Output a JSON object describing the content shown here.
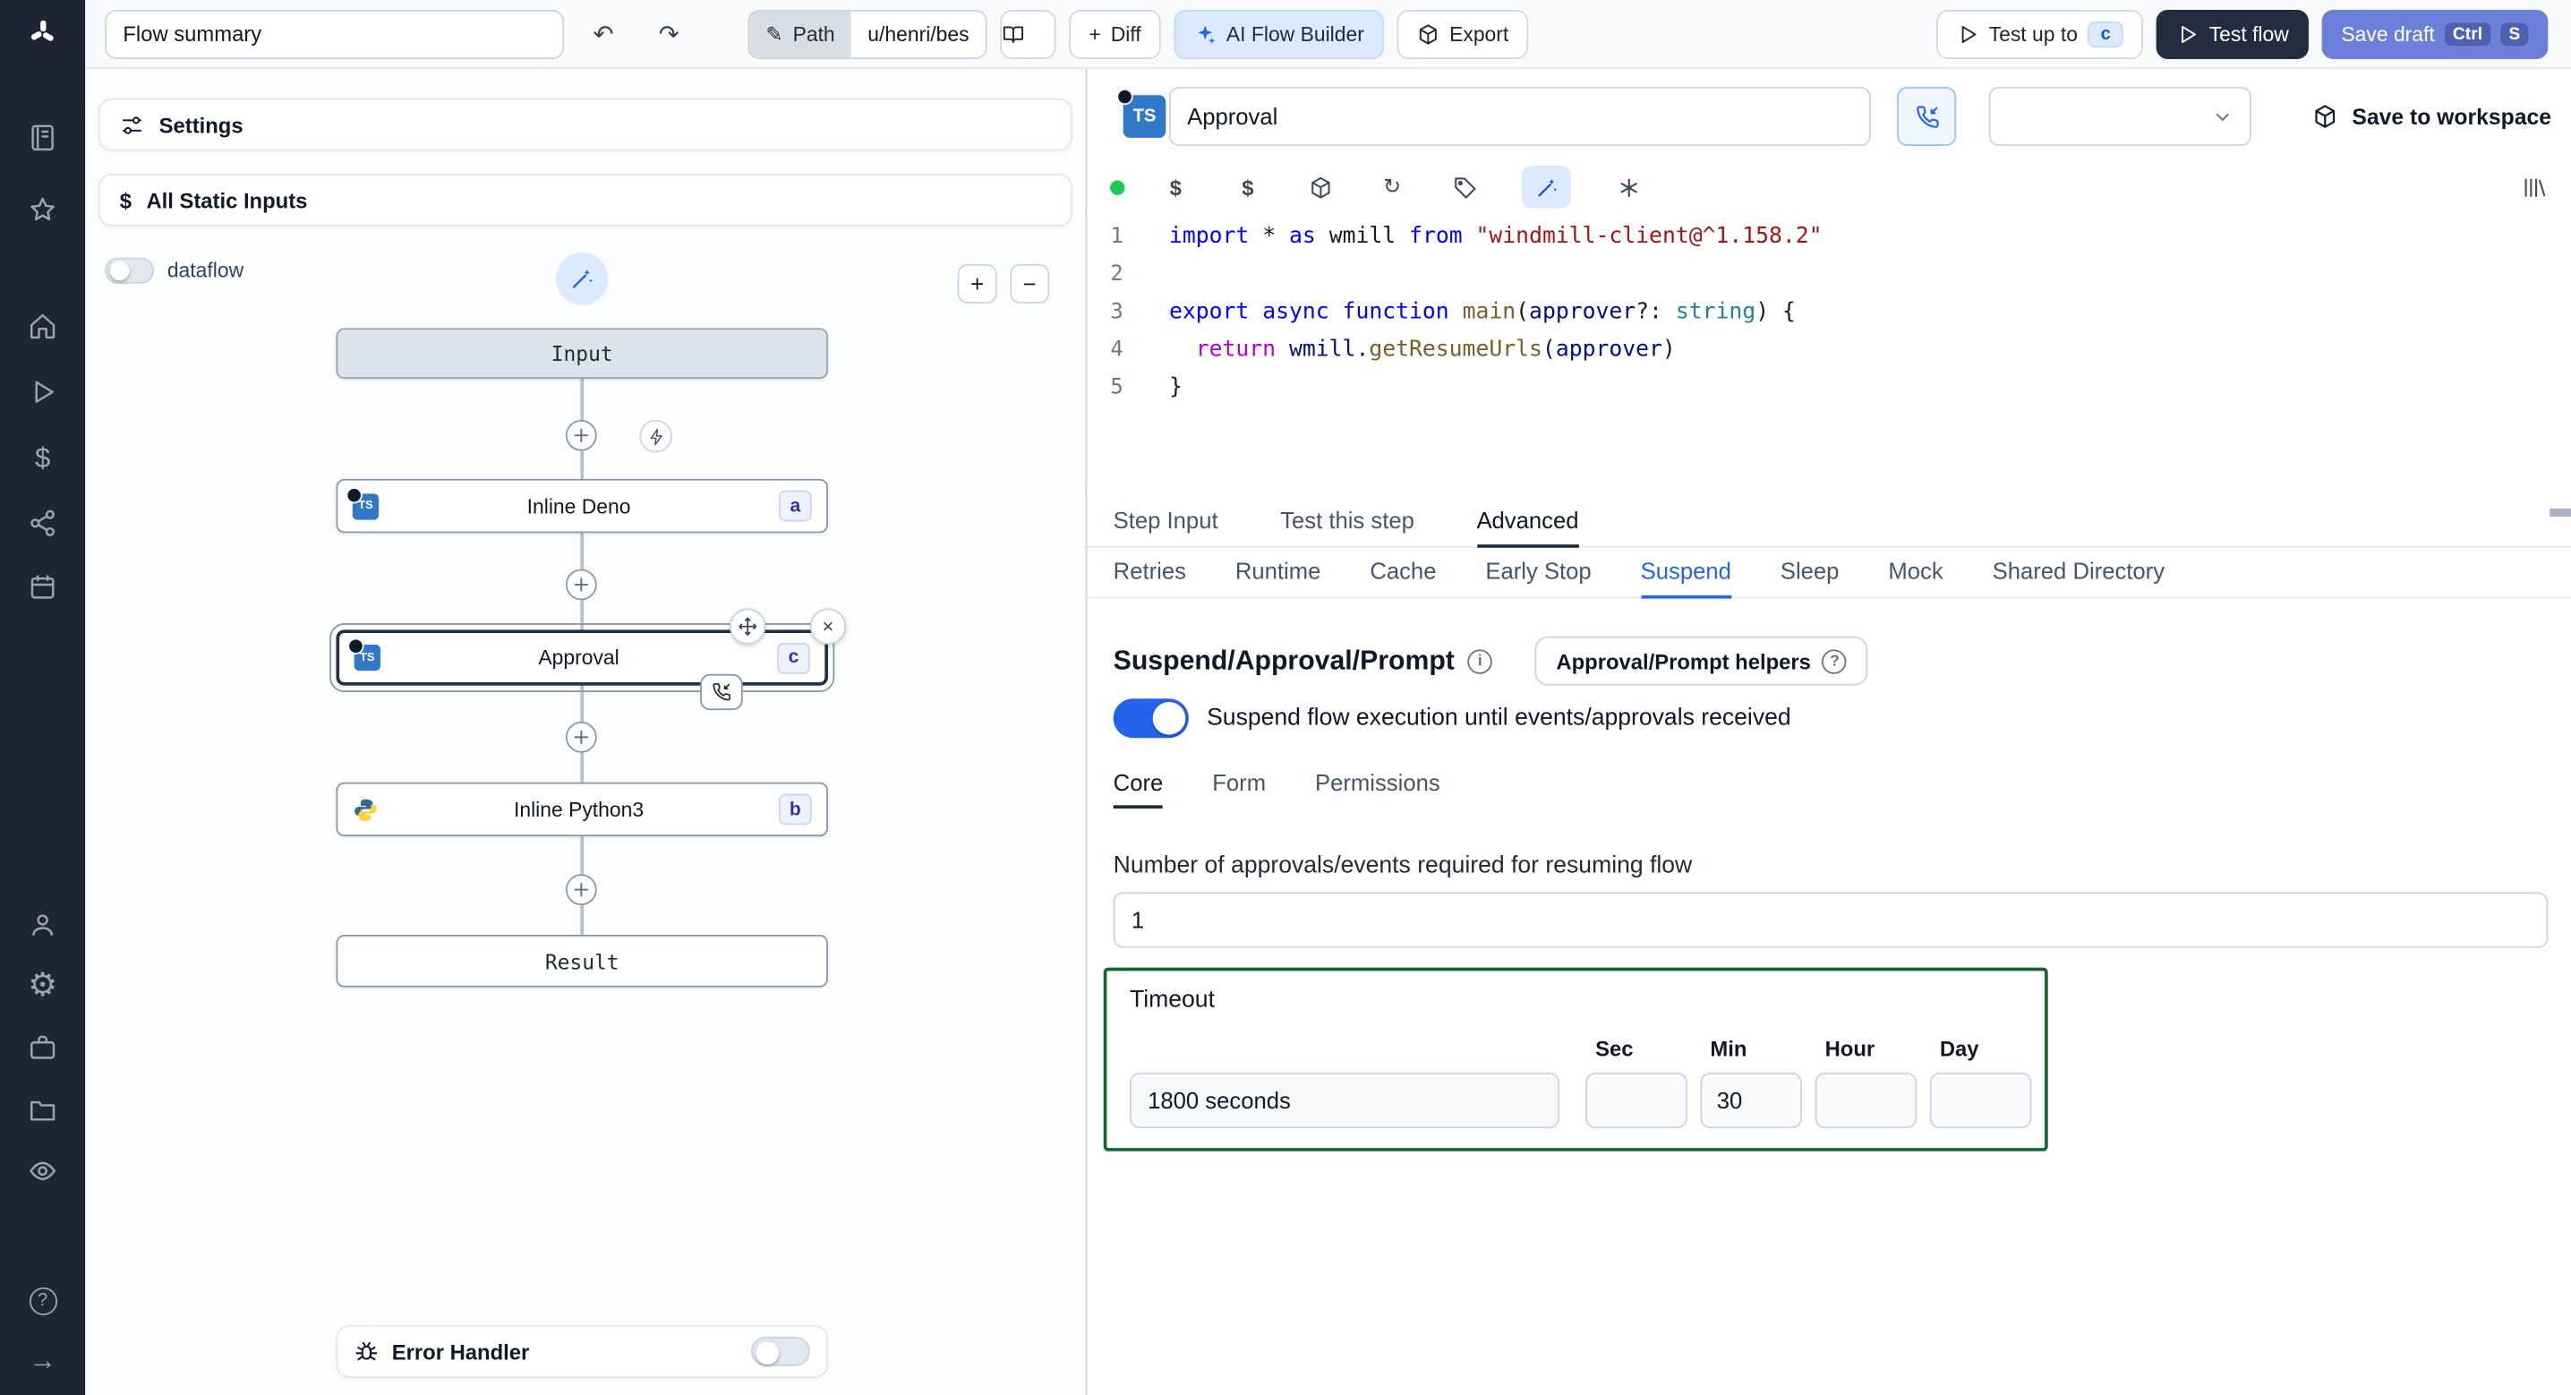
{
  "colors": {
    "accent": "#2563eb",
    "timeout_border": "#166534",
    "save_draft_bg": "#6c7fd8",
    "test_flow_bg": "#232d40",
    "sidebar_bg": "#1e2633",
    "ai_button_bg": "#dbeafe",
    "toggle_on": "#2563eb",
    "status_dot": "#22c55e",
    "ts_icon": "#3178c6"
  },
  "icons": {
    "undo": "↶",
    "redo": "↷",
    "refresh": "↻",
    "gear": "⚙",
    "arrow_right": "→",
    "pen": "✎",
    "close": "×",
    "plus": "+",
    "info": "i",
    "help": "?"
  },
  "topbar": {
    "flow_summary_value": "Flow summary",
    "path_label": "Path",
    "path_value": "u/henri/bes",
    "diff_label": "Diff",
    "ai_builder_label": "AI Flow Builder",
    "export_label": "Export",
    "test_up_to_label": "Test up to",
    "test_up_to_badge": "c",
    "test_flow_label": "Test flow",
    "save_draft_label": "Save draft",
    "save_draft_key_1": "Ctrl",
    "save_draft_key_2": "S"
  },
  "left_panel": {
    "settings_label": "Settings",
    "static_inputs_label": "All Static Inputs",
    "dataflow_label": "dataflow",
    "zoom_in": "+",
    "zoom_out": "−",
    "error_handler_label": "Error Handler",
    "nodes": {
      "input_label": "Input",
      "deno_label": "Inline Deno",
      "deno_badge": "a",
      "approval_label": "Approval",
      "approval_badge": "c",
      "python_label": "Inline Python3",
      "python_badge": "b",
      "result_label": "Result"
    }
  },
  "step_header": {
    "language": "TS",
    "name_value": "Approval",
    "save_to_workspace_label": "Save to workspace"
  },
  "editor": {
    "line_numbers": [
      "1",
      "2",
      "3",
      "4",
      "5"
    ],
    "lines": [
      [
        {
          "t": "import",
          "c": "kw"
        },
        {
          "t": " ",
          "c": "pl"
        },
        {
          "t": "*",
          "c": "pl"
        },
        {
          "t": " ",
          "c": "pl"
        },
        {
          "t": "as",
          "c": "kw"
        },
        {
          "t": " wmill ",
          "c": "pl"
        },
        {
          "t": "from",
          "c": "kw"
        },
        {
          "t": " ",
          "c": "pl"
        },
        {
          "t": "\"windmill-client@^1.158.2\"",
          "c": "str"
        }
      ],
      [],
      [
        {
          "t": "export",
          "c": "kw"
        },
        {
          "t": " ",
          "c": "pl"
        },
        {
          "t": "async",
          "c": "kw"
        },
        {
          "t": " ",
          "c": "pl"
        },
        {
          "t": "function",
          "c": "kw"
        },
        {
          "t": " ",
          "c": "pl"
        },
        {
          "t": "main",
          "c": "fn"
        },
        {
          "t": "(",
          "c": "pl"
        },
        {
          "t": "approver",
          "c": "var"
        },
        {
          "t": "?: ",
          "c": "pl"
        },
        {
          "t": "string",
          "c": "type"
        },
        {
          "t": ") {",
          "c": "pl"
        }
      ],
      [
        {
          "t": "  ",
          "c": "pl"
        },
        {
          "t": "return",
          "c": "ctrl"
        },
        {
          "t": " ",
          "c": "pl"
        },
        {
          "t": "wmill",
          "c": "var"
        },
        {
          "t": ".",
          "c": "pl"
        },
        {
          "t": "getResumeUrls",
          "c": "fn"
        },
        {
          "t": "(",
          "c": "pl"
        },
        {
          "t": "approver",
          "c": "var"
        },
        {
          "t": ")",
          "c": "pl"
        }
      ],
      [
        {
          "t": "}",
          "c": "pl"
        }
      ]
    ]
  },
  "tabs": {
    "main": [
      "Step Input",
      "Test this step",
      "Advanced"
    ],
    "main_selected": "Advanced",
    "advanced": [
      "Retries",
      "Runtime",
      "Cache",
      "Early Stop",
      "Suspend",
      "Sleep",
      "Mock",
      "Shared Directory"
    ],
    "advanced_selected": "Suspend"
  },
  "suspend": {
    "title": "Suspend/Approval/Prompt",
    "helpers_label": "Approval/Prompt helpers",
    "toggle_label": "Suspend flow execution until events/approvals received",
    "sub_tabs": [
      "Core",
      "Form",
      "Permissions"
    ],
    "sub_selected": "Core",
    "approvals_label": "Number of approvals/events required for resuming flow",
    "approvals_value": "1",
    "timeout_label": "Timeout",
    "timeout_value": "1800 seconds",
    "units": [
      {
        "label": "Sec",
        "value": ""
      },
      {
        "label": "Min",
        "value": "30"
      },
      {
        "label": "Hour",
        "value": ""
      },
      {
        "label": "Day",
        "value": ""
      }
    ]
  }
}
